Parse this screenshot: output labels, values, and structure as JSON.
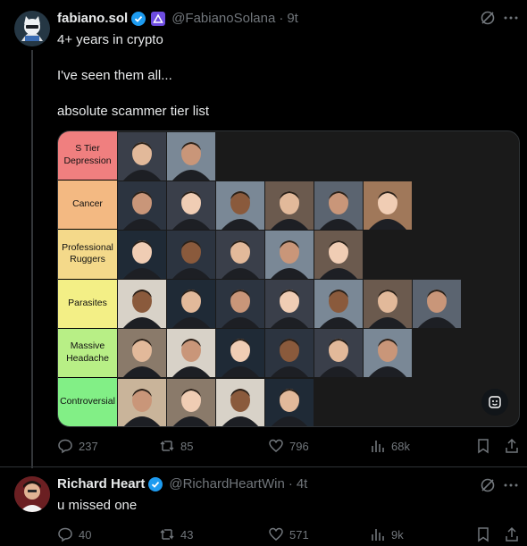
{
  "tweet": {
    "name": "fabiano.sol",
    "handle": "@FabianoSolana",
    "time": "9t",
    "lines": [
      "4+ years in crypto",
      "I've seen them all...",
      "absolute scammer tier list"
    ],
    "tiers": [
      {
        "label": "S Tier Depression",
        "color": "#f07f7f",
        "count": 2
      },
      {
        "label": "Cancer",
        "color": "#f3b982",
        "count": 6
      },
      {
        "label": "Professional Ruggers",
        "color": "#f4d98a",
        "count": 5
      },
      {
        "label": "Parasites",
        "color": "#f3ef86",
        "count": 7
      },
      {
        "label": "Massive Headache",
        "color": "#b8ef86",
        "count": 6
      },
      {
        "label": "Controversial",
        "color": "#82ef86",
        "count": 4
      }
    ],
    "stats": {
      "replies": "237",
      "reposts": "85",
      "likes": "796",
      "views": "68k"
    }
  },
  "reply": {
    "name": "Richard Heart",
    "handle": "@RichardHeartWin",
    "time": "4t",
    "text": "u missed one",
    "stats": {
      "replies": "40",
      "reposts": "43",
      "likes": "571",
      "views": "9k"
    }
  },
  "colors": {
    "verified": "#1d9bf0",
    "accent": "#1d9bf0"
  }
}
